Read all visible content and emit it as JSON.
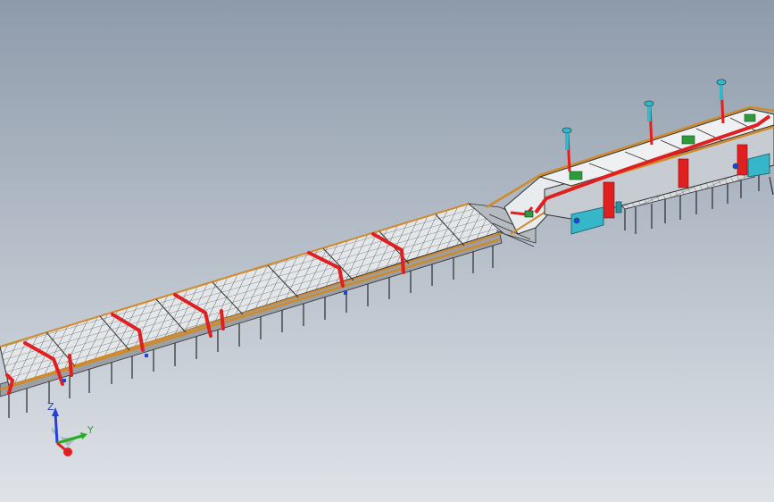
{
  "viewport": {
    "background_top": "#8e9bab",
    "background_bottom": "#d9dee4"
  },
  "model": {
    "colors": {
      "frame": "#3a3a3a",
      "rail": "#d08a2a",
      "duct": "#e02020",
      "panel": "#e9ecef",
      "equipment": "#35b7c9",
      "motor": "#2e9a3c",
      "housing": "#c7ccd2"
    }
  },
  "triad": {
    "z_label": "Z",
    "y_label": "Y",
    "x_color": "#e02020",
    "y_color": "#20b020",
    "z_color": "#2040e0"
  }
}
